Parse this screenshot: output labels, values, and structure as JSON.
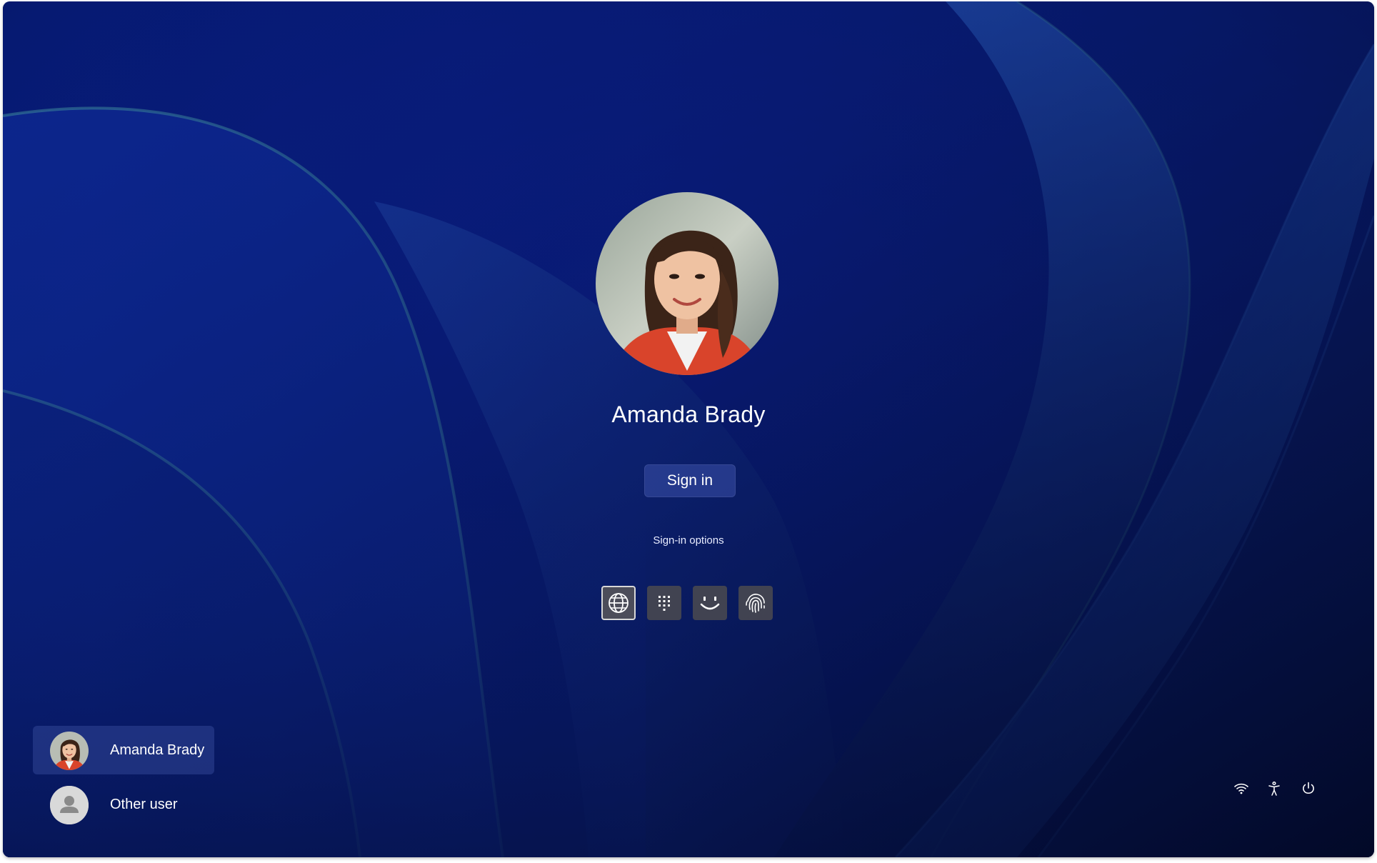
{
  "lock_screen": {
    "user": {
      "name": "Amanda Brady"
    },
    "sign_in_button": "Sign in",
    "sign_in_options_label": "Sign-in options",
    "sign_in_methods": [
      {
        "icon": "globe-icon",
        "selected": true
      },
      {
        "icon": "pin-keypad-icon",
        "selected": false
      },
      {
        "icon": "face-recognition-icon",
        "selected": false
      },
      {
        "icon": "fingerprint-icon",
        "selected": false
      }
    ]
  },
  "user_switcher": {
    "users": [
      {
        "name": "Amanda Brady",
        "active": true,
        "icon": "user-photo"
      },
      {
        "name": "Other user",
        "active": false,
        "icon": "person-icon"
      }
    ]
  },
  "system_tray": {
    "icons": [
      "wifi-icon",
      "accessibility-icon",
      "power-icon"
    ]
  },
  "colors": {
    "wallpaper_base": "#061a6e",
    "wallpaper_highlight": "#2a5bb8",
    "wallpaper_edge_glow": "#3f8e9a",
    "button_bg": "#3c50aa",
    "option_tile_bg": "#46464f"
  }
}
